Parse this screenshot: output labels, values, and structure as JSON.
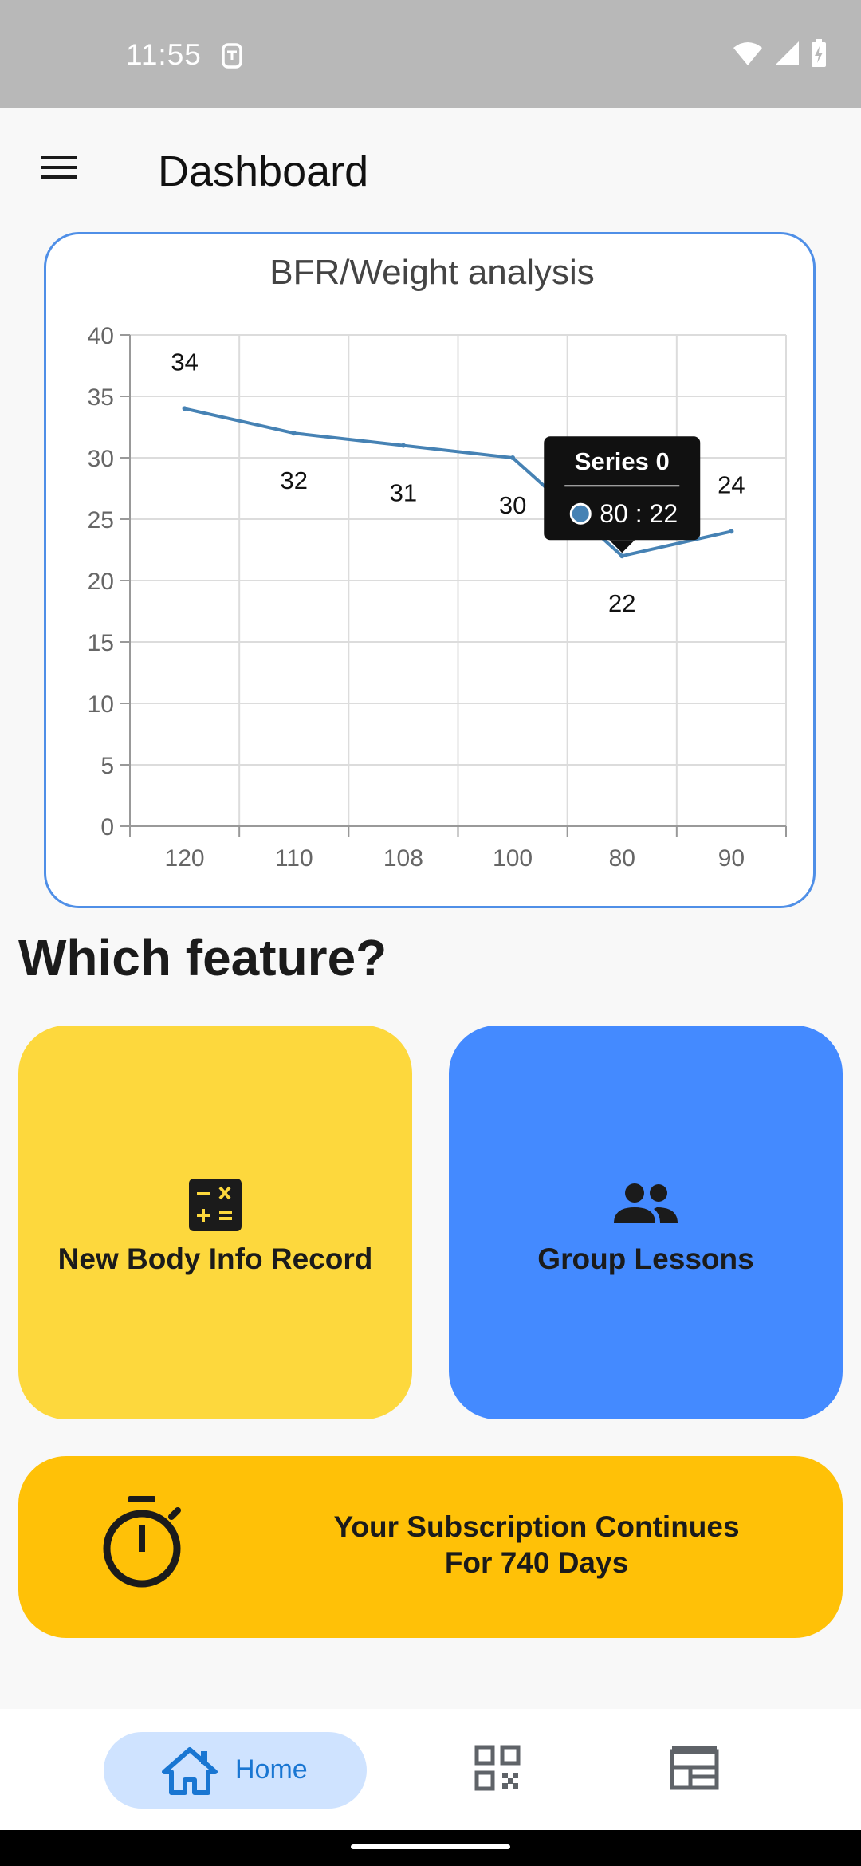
{
  "status_bar": {
    "time": "11:55"
  },
  "app_bar": {
    "title": "Dashboard"
  },
  "chart_data": {
    "type": "line",
    "title": "BFR/Weight analysis",
    "categories": [
      "120",
      "110",
      "108",
      "100",
      "80",
      "90"
    ],
    "series": [
      {
        "name": "Series 0",
        "values": [
          34,
          32,
          31,
          30,
          22,
          24
        ],
        "color": "#4682b4"
      }
    ],
    "ylim": [
      0,
      40
    ],
    "yticks": [
      "0",
      "5",
      "10",
      "15",
      "20",
      "25",
      "30",
      "35",
      "40"
    ],
    "grid": true,
    "tooltip": {
      "title": "Series 0",
      "text": "80 : 22",
      "point_index": 4
    }
  },
  "section": {
    "title": "Which feature?"
  },
  "tiles": [
    {
      "label": "New Body Info Record",
      "color": "#fdd83d",
      "icon": "calculate-icon"
    },
    {
      "label": "Group Lessons",
      "color": "#448aff",
      "icon": "group-icon"
    }
  ],
  "subscription": {
    "line1": "Your Subscription Continues",
    "line2": "For 740 Days",
    "icon": "timer-icon"
  },
  "bottom_nav": {
    "home_label": "Home"
  }
}
